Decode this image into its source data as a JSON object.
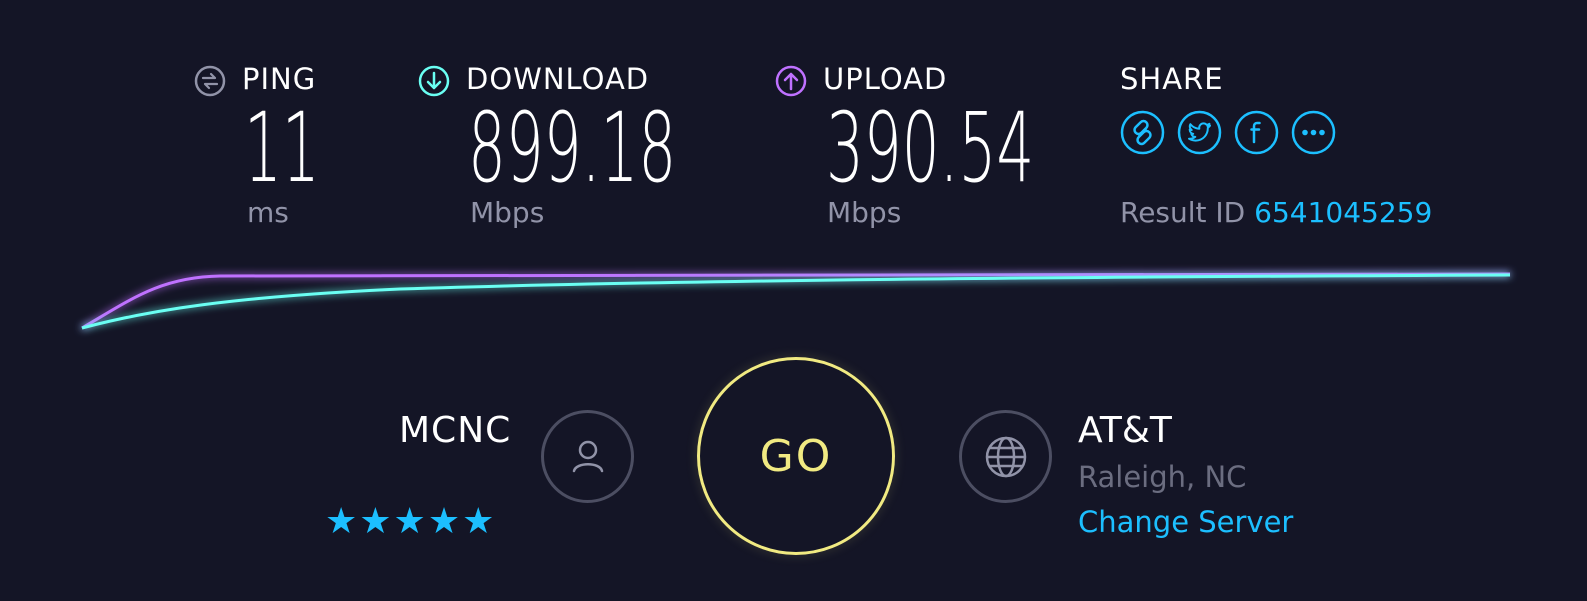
{
  "colors": {
    "background": "#141526",
    "ping_icon": "#9193a8",
    "download": "#6afff3",
    "upload": "#bf71ff",
    "link": "#1cbfff",
    "go": "#f1ea82",
    "muted": "#9193a8"
  },
  "ping": {
    "label": "PING",
    "value": "11",
    "unit": "ms",
    "icon": "ping-icon"
  },
  "download": {
    "label": "DOWNLOAD",
    "value": "899.18",
    "unit": "Mbps",
    "icon": "download-arrow-icon"
  },
  "upload": {
    "label": "UPLOAD",
    "value": "390.54",
    "unit": "Mbps",
    "icon": "upload-arrow-icon"
  },
  "share": {
    "label": "SHARE",
    "buttons": [
      "link-icon",
      "twitter-icon",
      "facebook-icon",
      "more-icon"
    ],
    "result_label": "Result ID",
    "result_id": "6541045259"
  },
  "isp": {
    "name": "MCNC",
    "rating": 5,
    "stars": "★★★★★",
    "icon": "user-icon"
  },
  "go_label": "GO",
  "server": {
    "name": "AT&T",
    "location": "Raleigh, NC",
    "change_label": "Change Server",
    "icon": "globe-icon"
  }
}
